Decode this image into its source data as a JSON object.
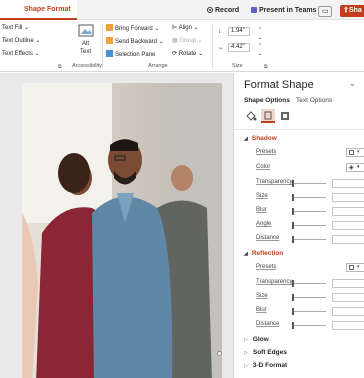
{
  "topbar": {
    "active_tab": "Shape Format",
    "record": "Record",
    "present": "Present in Teams",
    "share": "Sha"
  },
  "ribbon": {
    "text_fill": "Text Fill",
    "text_outline": "Text Outline",
    "text_effects": "Text Effects",
    "alt_text": [
      "Alt",
      "Text"
    ],
    "accessibility_group": "Accessibility",
    "bring_forward": "Bring Forward",
    "send_backward": "Send Backward",
    "selection_pane": "Selection Pane",
    "align": "Align",
    "group": "Group",
    "rotate": "Rotate",
    "arrange_group": "Arrange",
    "height_value": "1.94\"",
    "width_value": "4.42\"",
    "size_group": "Size"
  },
  "pane": {
    "title": "Format Shape",
    "tab_shape_options": "Shape Options",
    "tab_text_options": "Text Options",
    "shadow": {
      "title": "Shadow",
      "presets": "Presets",
      "color": "Color",
      "transparency": "Transparency",
      "size": "Size",
      "blur": "Blur",
      "angle": "Angle",
      "distance": "Distance"
    },
    "reflection": {
      "title": "Reflection",
      "presets": "Presets",
      "transparency": "Transparency",
      "size": "Size",
      "blur": "Blur",
      "distance": "Distance"
    },
    "glow": "Glow",
    "soft_edges": "Soft Edges",
    "format_3d": "3-D Format"
  },
  "colors": {
    "accent": "#c43e1c",
    "pane_bg": "#ffffff",
    "slide_bg": "#e9e9e9"
  }
}
